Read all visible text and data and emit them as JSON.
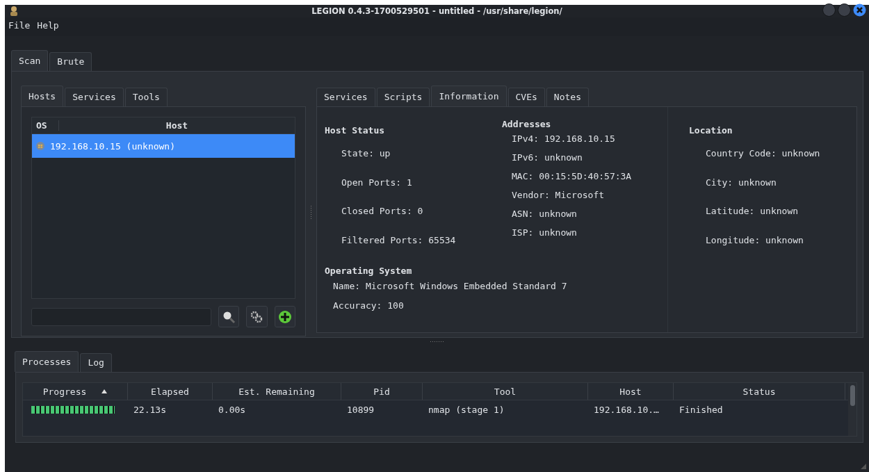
{
  "window": {
    "title": "LEGION 0.4.3-1700529501 - untitled - /usr/share/legion/"
  },
  "menu": [
    "File",
    "Help"
  ],
  "main_tabs": [
    {
      "label": "Scan",
      "selected": true
    },
    {
      "label": "Brute",
      "selected": false
    }
  ],
  "left_tabs": [
    {
      "label": "Hosts",
      "selected": true
    },
    {
      "label": "Services",
      "selected": false
    },
    {
      "label": "Tools",
      "selected": false
    }
  ],
  "hosts_table": {
    "columns": [
      "OS",
      "Host"
    ],
    "rows": [
      {
        "host": "192.168.10.15 (unknown)",
        "selected": true
      }
    ]
  },
  "right_tabs": [
    {
      "label": "Services",
      "selected": false
    },
    {
      "label": "Scripts",
      "selected": false
    },
    {
      "label": "Information",
      "selected": true
    },
    {
      "label": "CVEs",
      "selected": false
    },
    {
      "label": "Notes",
      "selected": false
    }
  ],
  "information": {
    "host_status": {
      "title": "Host Status",
      "items": [
        "State: up",
        "Open Ports: 1",
        "Closed Ports: 0",
        "Filtered Ports: 65534"
      ]
    },
    "addresses": {
      "title": "Addresses",
      "items": [
        "IPv4: 192.168.10.15",
        "IPv6: unknown",
        "MAC: 00:15:5D:40:57:3A",
        "Vendor: Microsoft",
        "ASN: unknown",
        "ISP: unknown"
      ]
    },
    "location": {
      "title": "Location",
      "items": [
        "Country Code: unknown",
        "City: unknown",
        "Latitude: unknown",
        "Longitude: unknown"
      ]
    },
    "operating_system": {
      "title": "Operating System",
      "items": [
        "Name: Microsoft Windows Embedded Standard 7",
        "Accuracy: 100"
      ]
    }
  },
  "bottom_tabs": [
    {
      "label": "Processes",
      "selected": true
    },
    {
      "label": "Log",
      "selected": false
    }
  ],
  "processes_table": {
    "columns": [
      "Progress",
      "Elapsed",
      "Est. Remaining",
      "Pid",
      "Tool",
      "Host",
      "Status"
    ],
    "rows": [
      {
        "level": 1,
        "elapsed": "22.13s",
        "remaining": "0.00s",
        "pid": "10899",
        "tool": "nmap (stage 1)",
        "host": "192.168.10.…",
        "status": "Finished"
      }
    ]
  }
}
